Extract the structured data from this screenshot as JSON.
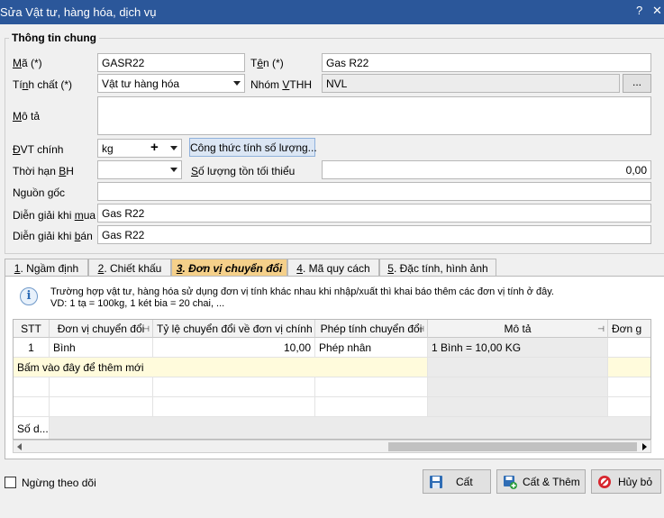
{
  "window": {
    "title": "Sửa Vật tư, hàng hóa, dịch vụ",
    "help_label": "?",
    "close_label": "✕"
  },
  "group": {
    "title": "Thông tin chung"
  },
  "form": {
    "ma": {
      "label_u": "M",
      "label_rest": "ã (*)",
      "value": "GASR22"
    },
    "ten": {
      "label_pre": "T",
      "label_u": "ê",
      "label_rest": "n (*)",
      "value": "Gas R22"
    },
    "tinh_chat": {
      "label_pre": "Tí",
      "label_u": "n",
      "label_rest": "h chất (*)",
      "value": "Vật tư hàng hóa"
    },
    "nhom_vthh": {
      "label_pre": "Nhóm ",
      "label_u": "V",
      "label_rest": "THH",
      "value": "NVL",
      "button_label": "..."
    },
    "mo_ta": {
      "label_u": "M",
      "label_rest": "ô tả",
      "value": ""
    },
    "dvt_chinh": {
      "label_u": "Đ",
      "label_rest": "VT chính",
      "value": "kg",
      "plus_label": "+",
      "button_label": "Công thức tính số lượng..."
    },
    "thoi_han_bh": {
      "label_pre": "Thời hạn ",
      "label_u": "B",
      "label_rest": "H",
      "value": ""
    },
    "so_luong_ton": {
      "label_u": "S",
      "label_rest": "ố lượng tồn tối thiểu",
      "value": "0,00"
    },
    "nguon_goc": {
      "label": "Nguồn gốc",
      "value": ""
    },
    "dien_giai_mua": {
      "label_pre": "Diễn giải khi ",
      "label_u": "m",
      "label_rest": "ua",
      "value": "Gas R22"
    },
    "dien_giai_ban": {
      "label_pre": "Diễn giải khi ",
      "label_u": "b",
      "label_rest": "án",
      "value": "Gas R22"
    }
  },
  "tabs": [
    {
      "num": "1",
      "label": ". Ngầm định",
      "active": false
    },
    {
      "num": "2",
      "label": ". Chiết khấu",
      "active": false
    },
    {
      "num": "3",
      "label": ". Đơn vị chuyển đổi",
      "active": true
    },
    {
      "num": "4",
      "label": ". Mã quy cách",
      "active": false
    },
    {
      "num": "5",
      "label": ". Đặc tính, hình ảnh",
      "active": false
    }
  ],
  "info": {
    "line1": "Trường hợp vật tư, hàng hóa sử dụng đơn vị tính khác nhau khi nhập/xuất thì khai báo thêm các đơn vị tính ở đây.",
    "line2": "VD: 1 tạ = 100kg, 1 két bia = 20 chai, ..."
  },
  "grid": {
    "headers": [
      "STT",
      "Đơn vị chuyển đổi",
      "Tỷ lệ chuyển đổi về đơn vị chính",
      "Phép tính chuyển đổi",
      "Mô tả",
      "Đơn g"
    ],
    "rows": [
      [
        "1",
        "Bình",
        "10,00",
        "Phép nhân",
        "1 Bình = 10,00 KG",
        ""
      ]
    ],
    "add_row_label": "Bấm vào đây để thêm mới",
    "footer_label": "Số d..."
  },
  "footer": {
    "stop_tracking_label": "Ngừng theo dõi",
    "stop_tracking_checked": false,
    "save_label": "Cất",
    "save_add_label": "Cất & Thêm",
    "cancel_label": "Hủy bỏ"
  },
  "colors": {
    "titlebar": "#2b579a",
    "active_tab": "#f5d08a",
    "add_row": "#fffbdc"
  }
}
